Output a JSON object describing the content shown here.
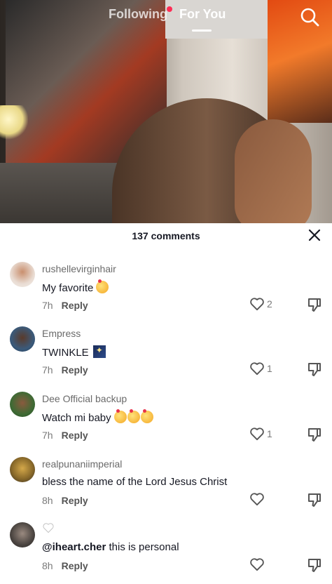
{
  "topnav": {
    "tabs": [
      {
        "label": "Following"
      },
      {
        "label": "For You",
        "active": true
      }
    ],
    "search_icon": "search-icon"
  },
  "sheet": {
    "count_label": "137 comments"
  },
  "comments": [
    {
      "username": "rushellevirginhair",
      "text": "My favorite",
      "emoji": "smiling-face-with-hearts",
      "time": "7h",
      "reply": "Reply",
      "likes": "2"
    },
    {
      "username": "Empress",
      "text": "TWINKLE",
      "emoji": "milky-way",
      "time": "7h",
      "reply": "Reply",
      "likes": "1"
    },
    {
      "username": "Dee Official backup",
      "text": "Watch mi baby",
      "emoji": "smiling-face-with-hearts x3",
      "time": "7h",
      "reply": "Reply",
      "likes": "1"
    },
    {
      "username": "realpunaniimperial",
      "text": "bless the name of the Lord Jesus Christ",
      "time": "8h",
      "reply": "Reply",
      "likes": ""
    },
    {
      "username": "",
      "mention": "@iheart.cher",
      "text": " this is personal",
      "time": "8h",
      "reply": "Reply",
      "likes": ""
    }
  ],
  "colors": {
    "accent": "#fe2c55",
    "text_primary": "#161823",
    "text_secondary": "#7a7a7a"
  }
}
